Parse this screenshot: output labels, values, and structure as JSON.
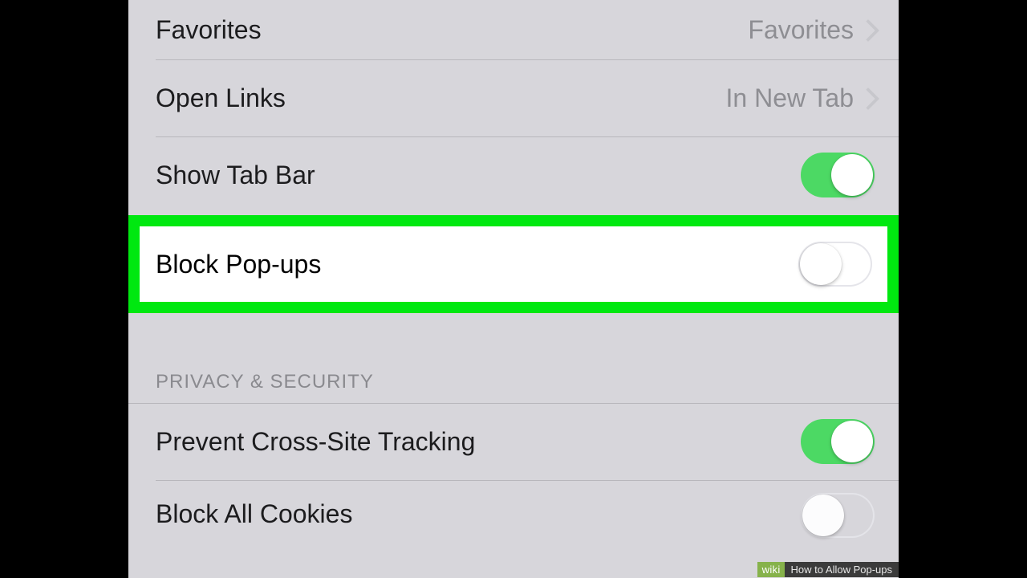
{
  "settings": {
    "group1": {
      "favorites": {
        "label": "Favorites",
        "value": "Favorites"
      },
      "open_links": {
        "label": "Open Links",
        "value": "In New Tab"
      },
      "show_tab_bar": {
        "label": "Show Tab Bar",
        "on": true
      },
      "block_popups": {
        "label": "Block Pop-ups",
        "on": false
      }
    },
    "section_header": "PRIVACY & SECURITY",
    "group2": {
      "prevent_tracking": {
        "label": "Prevent Cross-Site Tracking",
        "on": true
      },
      "block_cookies": {
        "label": "Block All Cookies",
        "on": false
      }
    }
  },
  "watermark": {
    "brand": "wiki",
    "title": "How to Allow Pop-ups"
  },
  "colors": {
    "highlight": "#00e810",
    "toggle_on": "#4cd964",
    "panel_bg": "#d7d6db"
  }
}
